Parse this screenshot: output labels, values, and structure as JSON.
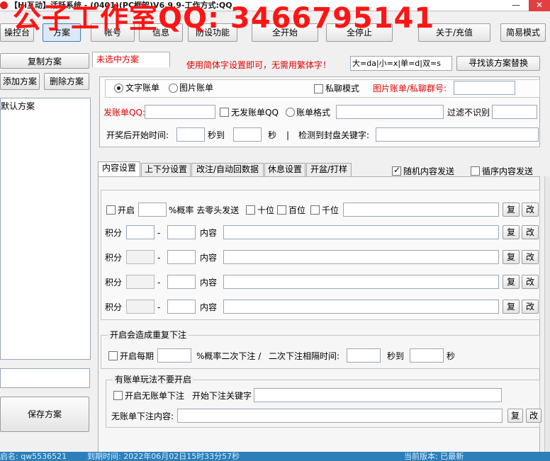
{
  "window": {
    "title": "【Hi互动】活跃系统 - (0401)(PC框架)V6.9.9-工作方式:QQ",
    "watermark": "公子工作室QQ: 3466795141",
    "minimize": "—",
    "close": "✕"
  },
  "toolbar": {
    "b1": "操控台",
    "b2": "方案",
    "b3": "帐号",
    "b4": "信息",
    "b5": "防设功能",
    "start_all": "全开始",
    "stop_all": "全停止",
    "about": "关于/充值",
    "simple_mode": "简易模式"
  },
  "left": {
    "copy_scheme": "复制方案",
    "add_scheme": "添加方案",
    "delete_scheme": "删除方案",
    "schemes": [
      "默认方案"
    ],
    "save_scheme": "保存方案"
  },
  "top": {
    "selected_tab": "未选中方案",
    "simplified_hint": "使用简体字设置即可，无需用繁体字！",
    "replace_field_value": "大=da|小=x|单=d|双=s",
    "find_replace": "寻找该方案替换"
  },
  "bill": {
    "text_bill": "文字账单",
    "image_bill": "图片账单",
    "private_mode": "私聊模式",
    "image_group_label": "图片账单/私聊群号:",
    "sender_label": "发账单QQ:",
    "no_sender": "无发账单QQ",
    "format_label": "账单格式",
    "filter_label": "过滤不识别",
    "start_time_label": "开奖后开始时间:",
    "sec_to": "秒到",
    "sec": "秒",
    "divider": "|",
    "keyword_label": "检测到封盘关键字:"
  },
  "tabs": [
    "内容设置",
    "上下分设置",
    "改注/自动回数据",
    "休息设置",
    "开盆/打样"
  ],
  "options": {
    "random_send": "随机内容发送",
    "loop_send": "循序内容发送"
  },
  "content": {
    "enable": "开启",
    "prob_label": "%概率 去零头发送",
    "tens": "十位",
    "hundreds": "百位",
    "thousands": "千位",
    "score": "积分",
    "dash": "-",
    "content_label": "内容",
    "copy": "复",
    "edit": "改"
  },
  "repeat": {
    "group_title": "开启会造成重复下注",
    "enable_each": "开启每期",
    "prob_label": "%概率二次下注 /",
    "interval_label": "二次下注相隔时间:",
    "sec_to": "秒到",
    "sec": "秒"
  },
  "nobill": {
    "group_title": "有账单玩法不要开启",
    "enable": "开启无账单下注",
    "keyword_label": "开始下注关键字",
    "content_label": "无账单下注内容:",
    "copy": "复",
    "edit": "改"
  },
  "status": {
    "user": "启名: qw5536521",
    "expire": "到期时间: 2022年06月02日15时33分57秒",
    "version": "当前版本: 已最新"
  },
  "colors": {
    "watermark": "#ff1414",
    "hint_red": "#e00000",
    "statusbar": "#2c7fb8"
  }
}
